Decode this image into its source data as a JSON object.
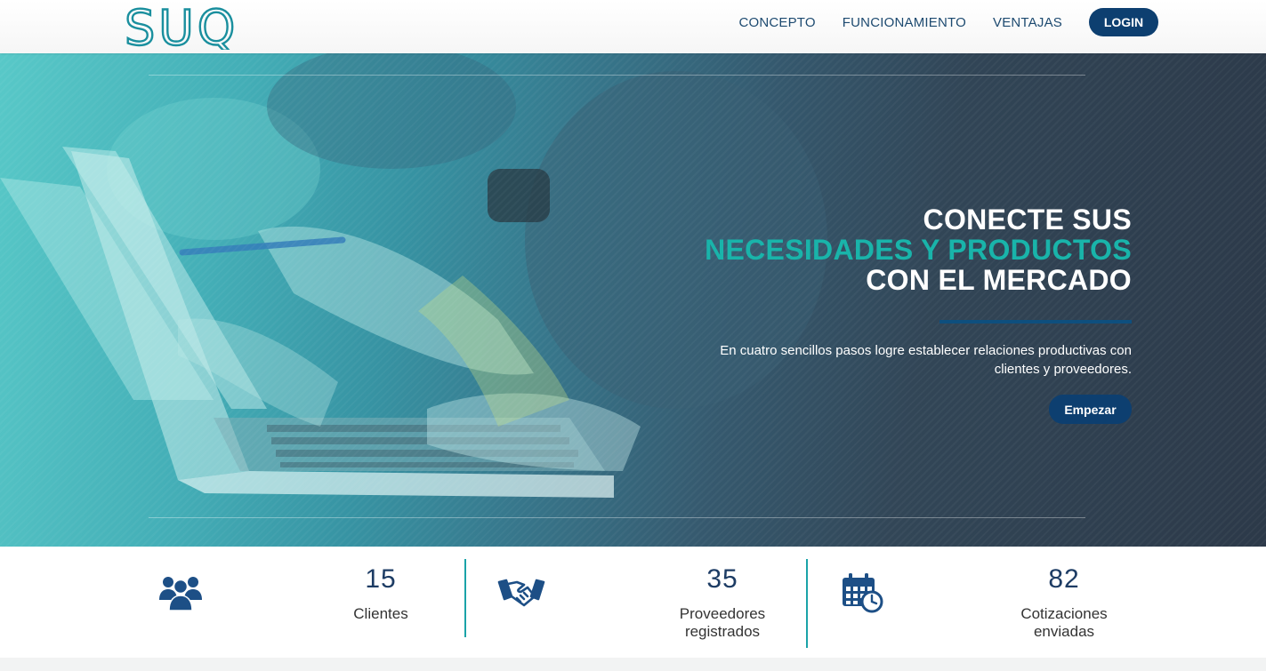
{
  "brand": {
    "logo_text": "SUQ",
    "primary": "#0d3f70",
    "accent": "#19b4aa",
    "logo_color": "#1a8f9e"
  },
  "nav": {
    "items": [
      "CONCEPTO",
      "FUNCIONAMIENTO",
      "VENTAJAS"
    ],
    "login_label": "LOGIN"
  },
  "hero": {
    "line1": "CONECTE SUS",
    "line2": "NECESIDADES Y PRODUCTOS",
    "line3": "CON EL MERCADO",
    "subtext_line1": "En cuatro sencillos pasos logre establecer relaciones productivas con",
    "subtext_line2": "clientes y proveedores.",
    "cta_label": "Empezar"
  },
  "stats": [
    {
      "icon": "users-icon",
      "value": "15",
      "label_line1": "Clientes",
      "label_line2": ""
    },
    {
      "icon": "handshake-icon",
      "value": "35",
      "label_line1": "Proveedores",
      "label_line2": "registrados"
    },
    {
      "icon": "calendar-clock-icon",
      "value": "82",
      "label_line1": "Cotizaciones",
      "label_line2": "enviadas"
    }
  ]
}
